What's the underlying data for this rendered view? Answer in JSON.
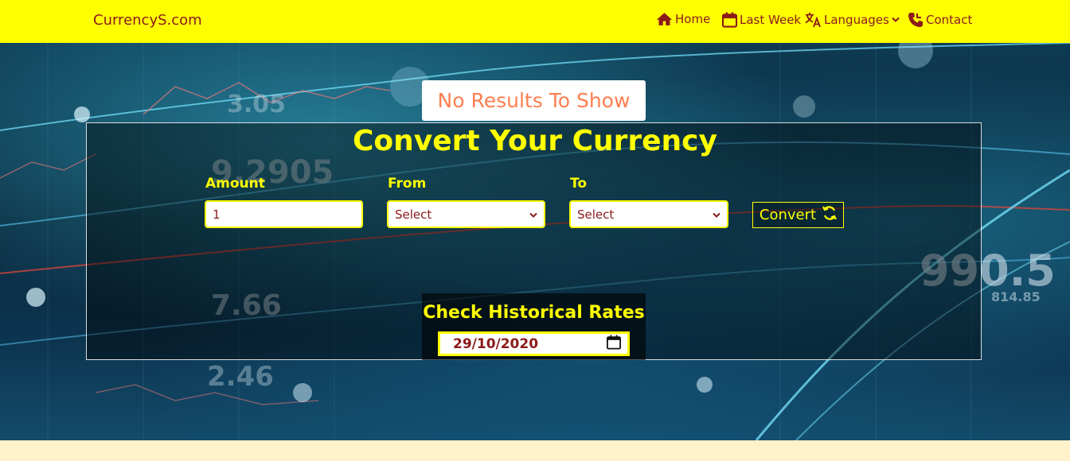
{
  "nav": {
    "brand": "CurrencyS.com",
    "items": [
      {
        "label": "Home",
        "icon": "home-icon"
      },
      {
        "label": "Last Week",
        "icon": "calendar-icon"
      },
      {
        "label": "Languages",
        "icon": "translate-icon"
      },
      {
        "label": "Contact",
        "icon": "phone-icon"
      }
    ]
  },
  "hero": {
    "no_results": "No Results To Show",
    "title": "Convert Your Currency",
    "amount_label": "Amount",
    "amount_value": "1",
    "from_label": "From",
    "from_value": "Select",
    "to_label": "To",
    "to_value": "Select",
    "convert_label": "Convert",
    "historical_label": "Check Historical Rates",
    "date_value": "29/10/2020"
  },
  "background_numbers": [
    "9.2905",
    "7.66",
    "990.5",
    "814.85",
    "3.05",
    "2.46"
  ],
  "colors": {
    "nav_bg": "#ffff00",
    "nav_text": "#8b1a1a",
    "accent_yellow": "#ffff00",
    "no_results_text": "#ff7f50",
    "page_bg": "#fff1c9"
  }
}
